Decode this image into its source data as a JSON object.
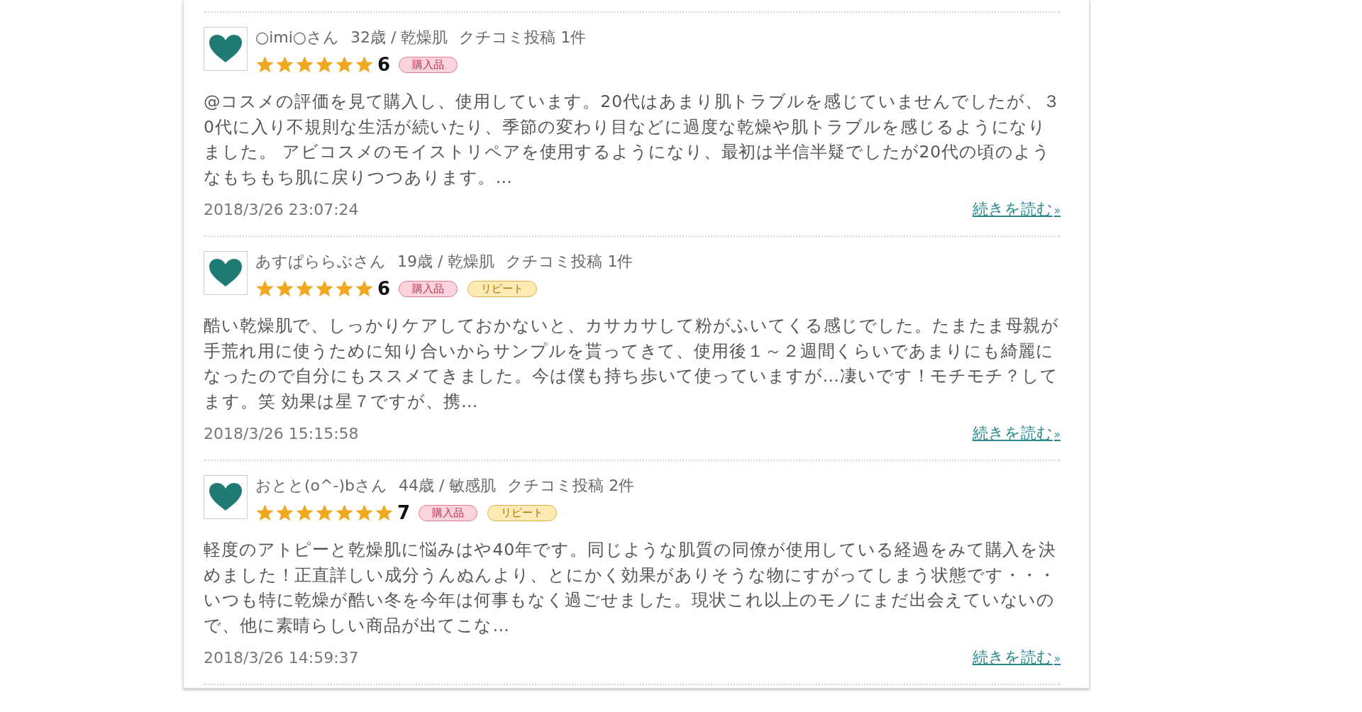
{
  "reviews": [
    {
      "name": "○imi○さん",
      "profile": "32歳 / 乾燥肌",
      "posts": "クチコミ投稿 1件",
      "stars": 6,
      "score": "6",
      "tags": [
        {
          "kind": "purchased",
          "label": "購入品"
        }
      ],
      "body": "@コスメの評価を見て購入し、使用しています。20代はあまり肌トラブルを感じていませんでしたが、３0代に入り不規則な生活が続いたり、季節の変わり目などに過度な乾燥や肌トラブルを感じるようになりました。 アビコスメのモイストリペアを使用するようになり、最初は半信半疑でしたが20代の頃のようなもちもち肌に戻りつつあります。…",
      "date": "2018/3/26 23:07:24",
      "more": "続きを読む",
      "more_mark": "»"
    },
    {
      "name": "あすぱららぶさん",
      "profile": "19歳 / 乾燥肌",
      "posts": "クチコミ投稿 1件",
      "stars": 6,
      "score": "6",
      "tags": [
        {
          "kind": "purchased",
          "label": "購入品"
        },
        {
          "kind": "repeat",
          "label": "リピート"
        }
      ],
      "body": "酷い乾燥肌で、しっかりケアしておかないと、カサカサして粉がふいてくる感じでした。たまたま母親が手荒れ用に使うために知り合いからサンプルを貰ってきて、使用後１～２週間くらいであまりにも綺麗になったので自分にもススメてきました。今は僕も持ち歩いて使っていますが…凄いです！モチモチ？してます。笑 効果は星７ですが、携…",
      "date": "2018/3/26 15:15:58",
      "more": "続きを読む",
      "more_mark": "»"
    },
    {
      "name": "おとと(o^-)bさん",
      "profile": "44歳 / 敏感肌",
      "posts": "クチコミ投稿 2件",
      "stars": 7,
      "score": "7",
      "tags": [
        {
          "kind": "purchased",
          "label": "購入品"
        },
        {
          "kind": "repeat",
          "label": "リピート"
        }
      ],
      "body": "軽度のアトピーと乾燥肌に悩みはや40年です。同じような肌質の同僚が使用している経過をみて購入を決めました！正直詳しい成分うんぬんより、とにかく効果がありそうな物にすがってしまう状態です・・・いつも特に乾燥が酷い冬を今年は何事もなく過ごせました。現状これ以上のモノにまだ出会えていないので、他に素晴らしい商品が出てこな…",
      "date": "2018/3/26 14:59:37",
      "more": "続きを読む",
      "more_mark": "»"
    }
  ]
}
